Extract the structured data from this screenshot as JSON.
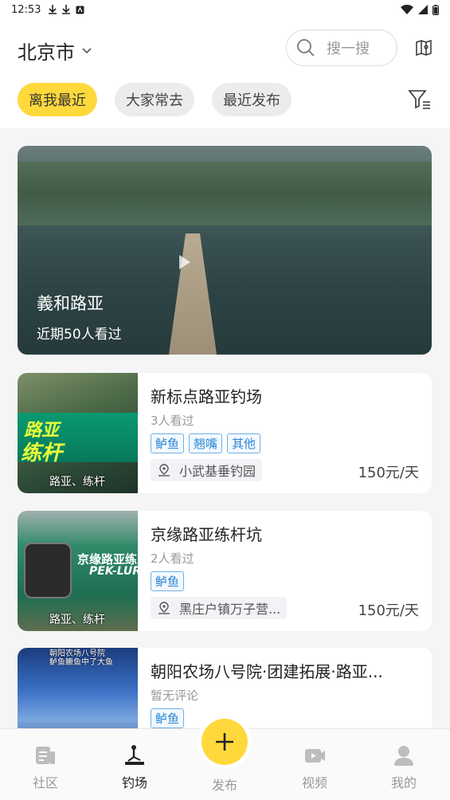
{
  "status_bar": {
    "time": "12:53"
  },
  "header": {
    "city": "北京市",
    "search_placeholder": "搜一搜"
  },
  "filters": [
    {
      "label": "离我最近",
      "active": true
    },
    {
      "label": "大家常去",
      "active": false
    },
    {
      "label": "最近发布",
      "active": false
    }
  ],
  "featured": {
    "title": "義和路亚",
    "subtitle": "近期50人看过"
  },
  "spots": [
    {
      "name": "新标点路亚钓场",
      "viewed": "3人看过",
      "tags": [
        "鲈鱼",
        "翘嘴",
        "其他"
      ],
      "location": "小武基垂钓园",
      "price": "150元/天",
      "thumb_tag": "路亚、练杆",
      "thumb_text_1": "路亚",
      "thumb_text_2": "练杆"
    },
    {
      "name": "京缘路亚练杆坑",
      "viewed": "2人看过",
      "tags": [
        "鲈鱼"
      ],
      "location": "黑庄户镇万子营...",
      "price": "150元/天",
      "thumb_tag": "路亚、练杆",
      "thumb_text_1": "京缘路亚练",
      "thumb_text_2": "PEK-LUR"
    },
    {
      "name": "朝阳农场八号院·团建拓展·路亚...",
      "viewed": "暂无评论",
      "tags": [
        "鲈鱼"
      ],
      "thumb_caption_1": "朝阳农场八号院",
      "thumb_caption_2": "鲈鱼鳜鱼中了大鱼"
    }
  ],
  "bottom_nav": {
    "community": "社区",
    "spots": "钓场",
    "publish": "发布",
    "video": "视频",
    "me": "我的"
  },
  "colors": {
    "accent": "#ffd93b",
    "tag_blue": "#2b86d6"
  }
}
